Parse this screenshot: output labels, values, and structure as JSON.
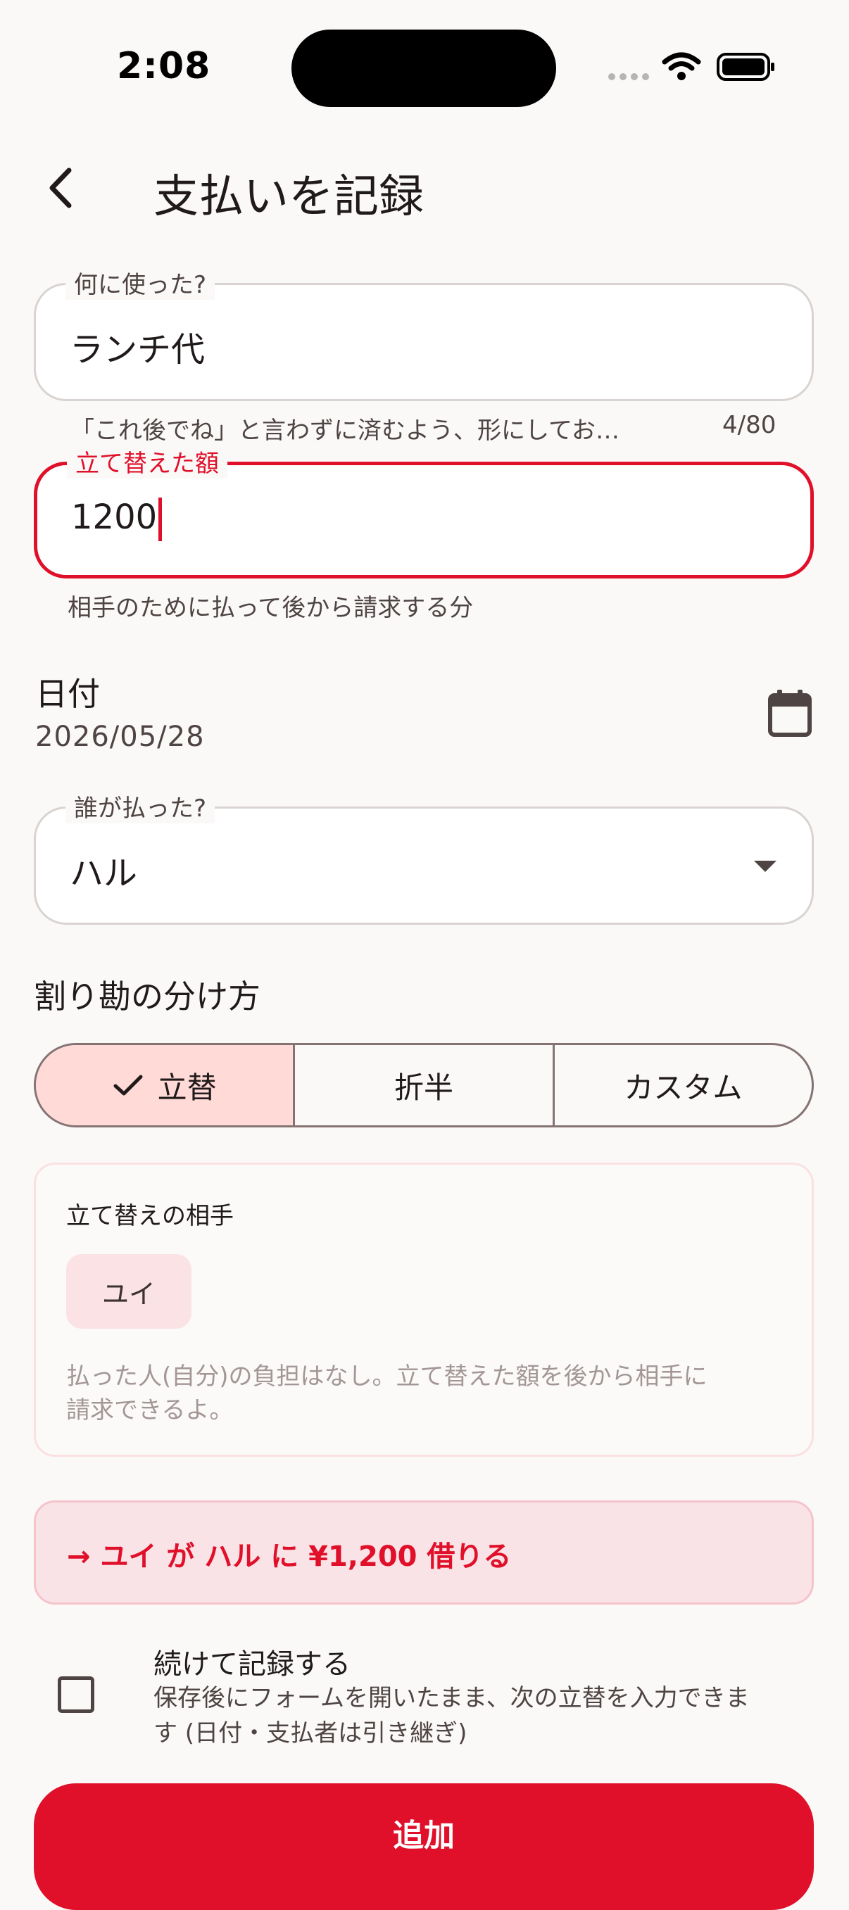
{
  "status_bar": {
    "time": "2:08"
  },
  "app_bar": {
    "title": "支払いを記録",
    "back_icon": "chevron-left-icon"
  },
  "description_field": {
    "label": "何に使った?",
    "value": "ランチ代",
    "helper": "「これ後でね」と言わずに済むよう、形にしてお…",
    "counter": "4/80"
  },
  "amount_field": {
    "label": "立て替えた額",
    "value": "1200",
    "helper": "相手のために払って後から請求する分"
  },
  "date": {
    "label": "日付",
    "value": "2026/05/28",
    "icon": "calendar-icon"
  },
  "payer_field": {
    "label": "誰が払った?",
    "value": "ハル",
    "icon": "dropdown-arrow-icon"
  },
  "split": {
    "heading": "割り勘の分け方",
    "options": [
      {
        "label": "立替",
        "selected": true
      },
      {
        "label": "折半",
        "selected": false
      },
      {
        "label": "カスタム",
        "selected": false
      }
    ]
  },
  "partner": {
    "heading": "立て替えの相手",
    "chip": "ユイ",
    "note": "払った人(自分)の負担はなし。立て替えた額を後から相手に請求できるよ。",
    "note_line1": "払った人(自分)の負担はなし。立て替えた額を後から相手に",
    "note_line2": "請求できるよ。"
  },
  "summary": {
    "text": "→ ユイ が ハル に ¥1,200 借りる"
  },
  "continue": {
    "title": "続けて記録する",
    "description_line1": "保存後にフォームを開いたまま、次の立替を入力できま",
    "description_line2": "す (日付・支払者は引き継ぎ)",
    "checked": false
  },
  "submit": {
    "label": "追加"
  },
  "colors": {
    "accent": "#e0102a",
    "selected_segment": "#ffdad6",
    "banner": "#fae3e6"
  }
}
